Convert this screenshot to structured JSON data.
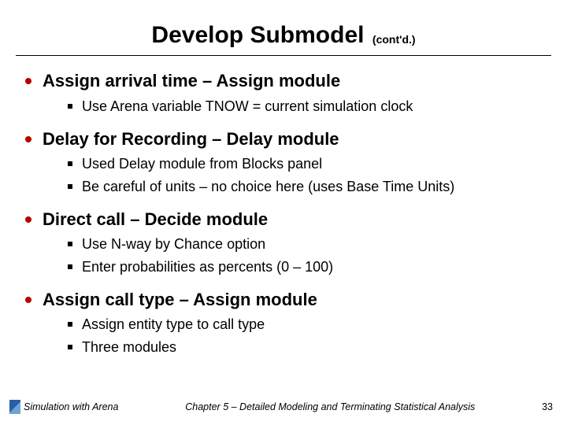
{
  "title": "Develop Submodel",
  "title_suffix": "(cont'd.)",
  "sections": [
    {
      "heading": "Assign arrival time – Assign module",
      "items": [
        "Use Arena variable TNOW = current simulation clock"
      ]
    },
    {
      "heading": "Delay for Recording – Delay module",
      "items": [
        "Used Delay module from Blocks panel",
        "Be careful of units – no choice here (uses Base Time Units)"
      ]
    },
    {
      "heading": "Direct call – Decide module",
      "items": [
        "Use N-way by Chance option",
        "Enter probabilities as percents (0 – 100)"
      ]
    },
    {
      "heading": "Assign call type – Assign module",
      "items": [
        "Assign entity type to call type",
        "Three modules"
      ]
    }
  ],
  "footer": {
    "left": "Simulation with Arena",
    "center": "Chapter 5 – Detailed Modeling and Terminating Statistical Analysis",
    "right": "33"
  }
}
